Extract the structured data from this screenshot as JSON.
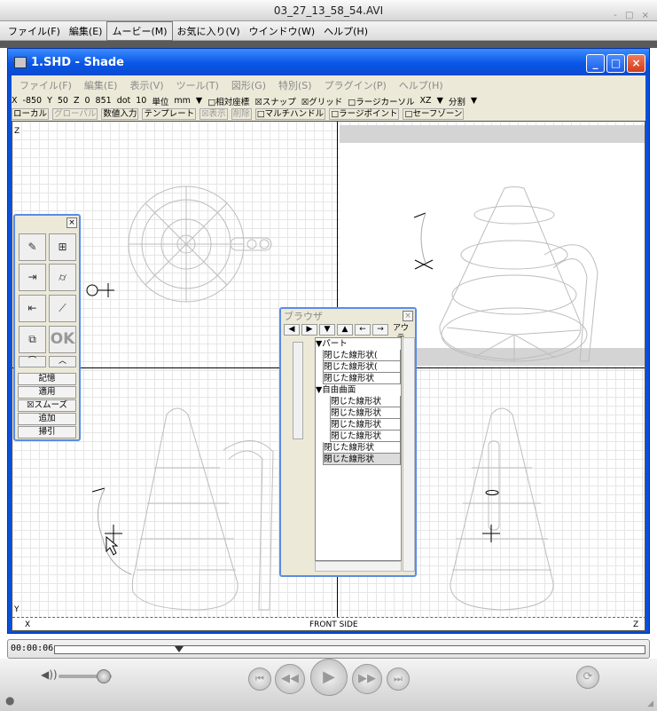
{
  "window_title": "03_27_13_58_54.AVI",
  "outer_controls": "- □ ×",
  "outer_menu": [
    "ファイル(F)",
    "編集(E)",
    "ムービー(M)",
    "お気に入り(V)",
    "ウインドウ(W)",
    "ヘルプ(H)"
  ],
  "outer_menu_active": "ムービー(M)",
  "shade_window": {
    "title": "1.SHD - Shade",
    "buttons": {
      "min": "_",
      "max": "□",
      "close": "×"
    },
    "menu": [
      "ファイル(F)",
      "編集(E)",
      "表示(V)",
      "ツール(T)",
      "図形(G)",
      "特別(S)",
      "プラグイン(P)",
      "ヘルプ(H)"
    ],
    "toolbar1": [
      "X",
      "-850",
      "Y",
      "50",
      "Z",
      "0",
      "851",
      "dot",
      "10",
      "単位",
      "mm",
      "▼",
      "□相対座標",
      "☒スナップ",
      "☒グリッド",
      "□ラージカーソル",
      "XZ",
      "▼",
      "分割",
      "▼"
    ],
    "toolbar2": [
      {
        "label": "ローカル",
        "dim": false
      },
      {
        "label": "グローバル",
        "dim": true
      },
      {
        "label": "数値入力",
        "dim": false
      },
      {
        "label": "テンプレート",
        "dim": false
      },
      {
        "label": "☒表示",
        "dim": true
      },
      {
        "label": "削除",
        "dim": true
      },
      {
        "label": "□マルチハンドル",
        "dim": false
      },
      {
        "label": "□ラージポイント",
        "dim": false
      },
      {
        "label": "□セーフゾーン",
        "dim": false
      }
    ],
    "viewport_labels": {
      "z_axis": "Z",
      "y_axis": "Y",
      "x_axis": "X",
      "front_side": "FRONT SIDE",
      "z_right": "Z"
    }
  },
  "tool_palette": {
    "close": "×",
    "ok_label": "OK",
    "text_buttons": [
      "記憶",
      "適用",
      "☒スムーズ",
      "追加",
      "掃引"
    ]
  },
  "browser": {
    "title": "ブラウザ",
    "close": "×",
    "tool_arrows": [
      "◀",
      "▶",
      "▼",
      "▲",
      "←",
      "→"
    ],
    "tool_label": "アウテ",
    "items": [
      {
        "text": "▼パート",
        "kind": "head",
        "indent": 0
      },
      {
        "text": "閉じた線形状(",
        "kind": "item",
        "indent": 1
      },
      {
        "text": "閉じた線形状(",
        "kind": "item",
        "indent": 1
      },
      {
        "text": "閉じた線形状",
        "kind": "item",
        "indent": 1
      },
      {
        "text": "▼自由曲面",
        "kind": "head",
        "indent": 0
      },
      {
        "text": "閉じた線形状",
        "kind": "item",
        "indent": 2
      },
      {
        "text": "閉じた線形状",
        "kind": "item",
        "indent": 2
      },
      {
        "text": "閉じた線形状",
        "kind": "item",
        "indent": 2
      },
      {
        "text": "閉じた線形状",
        "kind": "item",
        "indent": 2
      },
      {
        "text": "閉じた線形状",
        "kind": "item",
        "indent": 1
      },
      {
        "text": "閉じた線形状",
        "kind": "sel",
        "indent": 1
      }
    ]
  },
  "player": {
    "time": "00:00:06",
    "progress": 0.21,
    "volume": 0.85,
    "buttons": [
      "skip-back",
      "rewind",
      "play",
      "fast-forward",
      "skip-forward"
    ]
  }
}
